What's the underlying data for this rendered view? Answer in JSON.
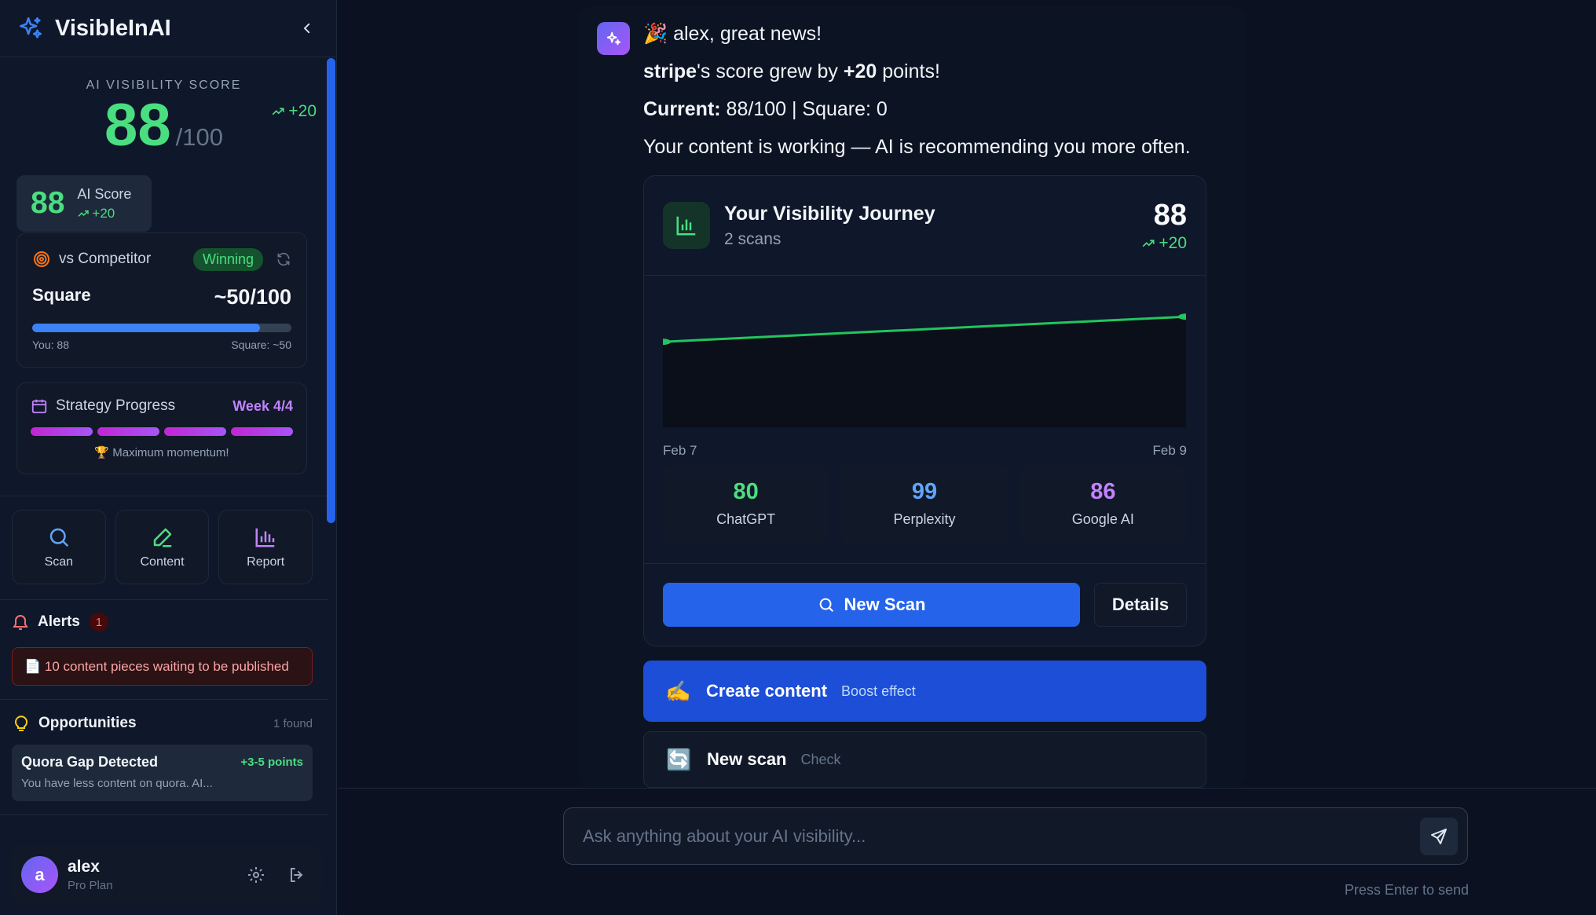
{
  "app": {
    "name": "VisibleInAI"
  },
  "sidebar": {
    "score_label": "AI VISIBILITY SCORE",
    "score_value": "88",
    "score_max": "/100",
    "score_delta": "+20",
    "mini": {
      "value": "88",
      "label": "AI Score",
      "delta": "+20"
    },
    "competitor": {
      "title": "vs Competitor",
      "status": "Winning",
      "name": "Square",
      "score": "~50/100",
      "you_label": "You: 88",
      "them_label": "Square: ~50",
      "you_fraction": 0.88
    },
    "strategy": {
      "title": "Strategy Progress",
      "week": "Week 4/4",
      "segments_done": 4,
      "note": "🏆 Maximum momentum!"
    },
    "quick_actions": [
      {
        "label": "Scan",
        "icon": "search-icon"
      },
      {
        "label": "Content",
        "icon": "pen-icon"
      },
      {
        "label": "Report",
        "icon": "bar-chart-icon"
      }
    ],
    "alerts": {
      "title": "Alerts",
      "count": "1",
      "item": "📄 10 content pieces waiting to be published"
    },
    "opportunities": {
      "title": "Opportunities",
      "found": "1 found",
      "item": {
        "name": "Quora Gap Detected",
        "points": "+3-5 points",
        "desc": "You have less content on quora. AI..."
      }
    },
    "user": {
      "initial": "a",
      "name": "alex",
      "plan": "Pro Plan"
    }
  },
  "chat": {
    "greeting": "🎉 alex, great news!",
    "line2_brand": "stripe",
    "line2_mid": "'s score grew by ",
    "line2_points": "+20",
    "line2_end": " points!",
    "line3_label": "Current:",
    "line3_rest": " 88/100 | Square: 0",
    "line4": "Your content is working — AI is recommending you more often.",
    "journey": {
      "title": "Your Visibility Journey",
      "subtitle": "2 scans",
      "score": "88",
      "delta": "+20",
      "x_start": "Feb 7",
      "x_end": "Feb 9",
      "engines": [
        {
          "value": "80",
          "name": "ChatGPT",
          "color": "#4ade80"
        },
        {
          "value": "99",
          "name": "Perplexity",
          "color": "#60a5fa"
        },
        {
          "value": "86",
          "name": "Google AI",
          "color": "#c084fc"
        }
      ],
      "new_scan": "New Scan",
      "details": "Details"
    },
    "actions": [
      {
        "emoji": "✍️",
        "title": "Create content",
        "sub": "Boost effect"
      },
      {
        "emoji": "🔄",
        "title": "New scan",
        "sub": "Check"
      }
    ],
    "input_placeholder": "Ask anything about your AI visibility...",
    "hint": "Press Enter to send"
  },
  "chart_data": {
    "type": "line",
    "x": [
      "Feb 7",
      "Feb 9"
    ],
    "series": [
      {
        "values": [
          68,
          88
        ]
      }
    ],
    "color": "#22c55e"
  }
}
